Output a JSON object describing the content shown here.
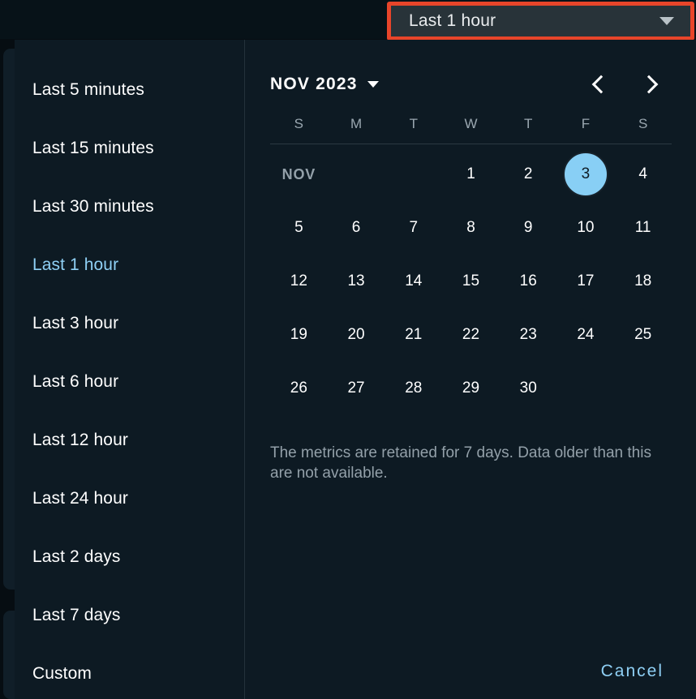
{
  "colors": {
    "highlight_border": "#e8452a",
    "accent_blue": "#8fd0f5",
    "panel_bg": "#0d1a23",
    "header_bg": "#071218",
    "select_bg": "#283339",
    "selected_day_bg": "#88cff5"
  },
  "range_select": {
    "value": "Last 1 hour",
    "caret_icon": "chevron-down-icon"
  },
  "presets": {
    "items": [
      {
        "label": "Last 5 minutes",
        "selected": false
      },
      {
        "label": "Last 15 minutes",
        "selected": false
      },
      {
        "label": "Last 30 minutes",
        "selected": false
      },
      {
        "label": "Last 1 hour",
        "selected": true
      },
      {
        "label": "Last 3 hour",
        "selected": false
      },
      {
        "label": "Last 6 hour",
        "selected": false
      },
      {
        "label": "Last 12 hour",
        "selected": false
      },
      {
        "label": "Last 24 hour",
        "selected": false
      },
      {
        "label": "Last 2 days",
        "selected": false
      },
      {
        "label": "Last 7 days",
        "selected": false
      },
      {
        "label": "Custom",
        "selected": false
      }
    ]
  },
  "calendar": {
    "month_year": "NOV 2023",
    "month_caret_icon": "chevron-down-icon",
    "prev_icon": "chevron-left-icon",
    "next_icon": "chevron-right-icon",
    "weekdays": [
      "S",
      "M",
      "T",
      "W",
      "T",
      "F",
      "S"
    ],
    "month_abbr_in_grid": "NOV",
    "selected_day": 3,
    "weeks": [
      [
        "NOV",
        "",
        "",
        "1",
        "2",
        "3",
        "4"
      ],
      [
        "5",
        "6",
        "7",
        "8",
        "9",
        "10",
        "11"
      ],
      [
        "12",
        "13",
        "14",
        "15",
        "16",
        "17",
        "18"
      ],
      [
        "19",
        "20",
        "21",
        "22",
        "23",
        "24",
        "25"
      ],
      [
        "26",
        "27",
        "28",
        "29",
        "30",
        "",
        ""
      ]
    ]
  },
  "retention_note": "The metrics are retained for 7 days. Data older than this are not available.",
  "cancel_label": "Cancel"
}
